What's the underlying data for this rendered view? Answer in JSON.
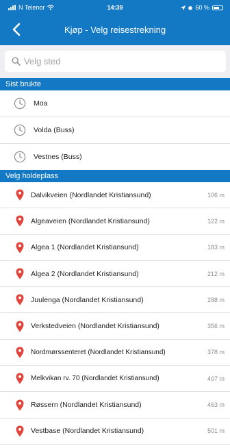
{
  "status_bar": {
    "carrier": "N Telenor",
    "time": "14:39",
    "battery": "60 %"
  },
  "nav": {
    "back_icon": "chevron-left-icon",
    "title": "Kjøp - Velg reisestrekning"
  },
  "search": {
    "icon": "search-icon",
    "placeholder": "Velg sted",
    "value": ""
  },
  "recent": {
    "header": "Sist brukte",
    "items": [
      {
        "label": "Moa",
        "icon": "clock-icon"
      },
      {
        "label": "Volda (Buss)",
        "icon": "clock-icon"
      },
      {
        "label": "Vestnes (Buss)",
        "icon": "clock-icon"
      }
    ]
  },
  "stops": {
    "header": "Velg holdeplass",
    "items": [
      {
        "label": "Dalvikveien (Nordlandet Kristiansund)",
        "distance": "106 m"
      },
      {
        "label": "Algeaveien (Nordlandet Kristiansund)",
        "distance": "122 m"
      },
      {
        "label": "Algea 1 (Nordlandet Kristiansund)",
        "distance": "183 m"
      },
      {
        "label": "Algea 2 (Nordlandet Kristiansund)",
        "distance": "212 m"
      },
      {
        "label": "Juulenga (Nordlandet Kristiansund)",
        "distance": "288 m"
      },
      {
        "label": "Verkstedveien (Nordlandet Kristiansund)",
        "distance": "356 m"
      },
      {
        "label": "Nordmørssenteret (Nordlandet Kristiansund)",
        "distance": "378 m"
      },
      {
        "label": "Melkvikan rv. 70 (Nordlandet Kristiansund)",
        "distance": "407 m"
      },
      {
        "label": "Røssern (Nordlandet Kristiansund)",
        "distance": "463 m"
      },
      {
        "label": "Vestbase (Nordlandet Kristiansund)",
        "distance": "501 m"
      }
    ]
  },
  "colors": {
    "accent": "#1479c4",
    "pin": "#e0443a",
    "search_bg": "#efeff3"
  }
}
